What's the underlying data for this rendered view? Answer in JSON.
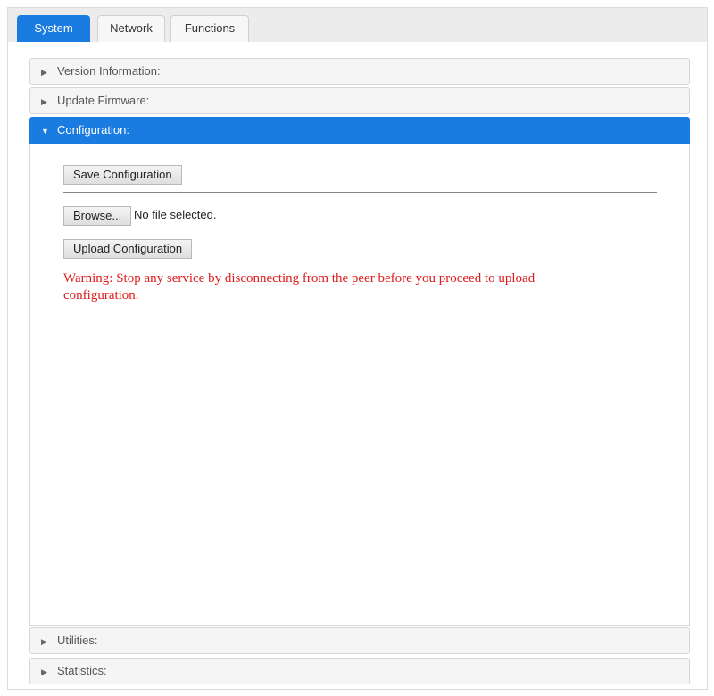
{
  "tabs": [
    {
      "label": "System"
    },
    {
      "label": "Network"
    },
    {
      "label": "Functions"
    }
  ],
  "sections": {
    "version_information": "Version Information:",
    "update_firmware": "Update Firmware:",
    "configuration": "Configuration:",
    "utilities": "Utilities:",
    "statistics": "Statistics:"
  },
  "configuration": {
    "save_button": "Save Configuration",
    "browse_button": "Browse...",
    "file_status": "No file selected.",
    "upload_button": "Upload Configuration",
    "warning": "Warning: Stop any service by disconnecting from the peer before you proceed to upload configuration."
  },
  "colors": {
    "accent": "#1a7be0",
    "warning": "#e01b1b"
  },
  "icons": {
    "collapsed": "triangle-right-icon",
    "expanded": "triangle-down-icon"
  }
}
